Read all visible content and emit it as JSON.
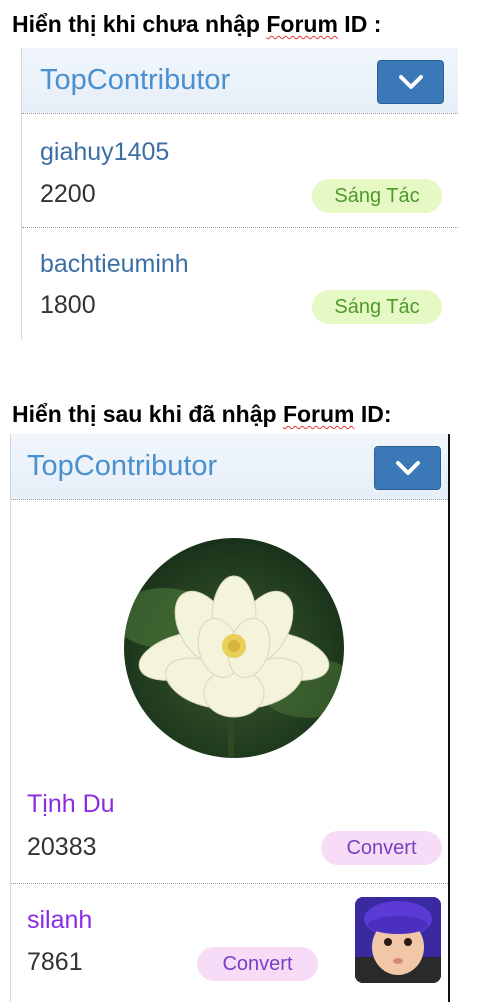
{
  "section1": {
    "heading_before": "Hiển thị khi chưa nhập ",
    "heading_underlined": "Forum",
    "heading_after": " ID :",
    "panel": {
      "title": "TopContributor",
      "dropdown_icon": "chevron-down-icon",
      "items": [
        {
          "name": "giahuy1405",
          "score": "2200",
          "tag": "Sáng Tác"
        },
        {
          "name": "bachtieuminh",
          "score": "1800",
          "tag": "Sáng Tác"
        }
      ]
    }
  },
  "section2": {
    "heading_before": "Hiển thị sau khi đã nhập ",
    "heading_underlined": "Forum",
    "heading_after": " ID:",
    "panel": {
      "title": "TopContributor",
      "dropdown_icon": "chevron-down-icon",
      "featured": {
        "name": "Tịnh Du",
        "score": "20383",
        "tag": "Convert",
        "avatar": "lotus-flower-avatar"
      },
      "items": [
        {
          "name": "silanh",
          "score": "7861",
          "tag": "Convert",
          "avatar": "baby-photo-avatar"
        }
      ]
    }
  },
  "colors": {
    "title_blue": "#4a90cf",
    "link_blue": "#3b6fa6",
    "purple_name": "#8a2be2",
    "dropdown_bg": "#3a78b8",
    "tag_green_bg": "#e6f8c4",
    "tag_pink_bg": "#f7dcf8"
  }
}
